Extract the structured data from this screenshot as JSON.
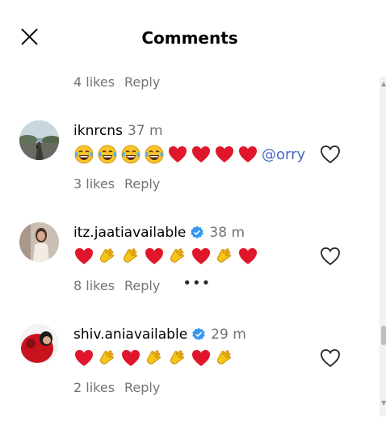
{
  "header": {
    "title": "Comments",
    "close_icon": "close-icon"
  },
  "top_meta": {
    "likes": "4 likes",
    "reply": "Reply"
  },
  "comments": [
    {
      "username": "iknrcns",
      "verified": false,
      "time": "37 m",
      "emojis": [
        "grin-tears",
        "grin-tears",
        "grin-tears",
        "grin-tears",
        "heart",
        "heart",
        "heart",
        "heart"
      ],
      "mention": "@orry",
      "likes": "3 likes",
      "reply": "Reply",
      "more": ""
    },
    {
      "username": "itz.jaatiavailable",
      "verified": true,
      "time": "38 m",
      "emojis": [
        "heart",
        "clap",
        "clap",
        "heart",
        "clap",
        "heart",
        "clap",
        "heart"
      ],
      "mention": "",
      "likes": "8 likes",
      "reply": "Reply",
      "more": "•••"
    },
    {
      "username": "shiv.aniavailable",
      "verified": true,
      "time": "29 m",
      "emojis": [
        "heart",
        "clap",
        "heart",
        "clap",
        "clap",
        "heart",
        "clap"
      ],
      "mention": "",
      "likes": "2 likes",
      "reply": "Reply",
      "more": ""
    }
  ],
  "colors": {
    "heart": "#e0172b",
    "clap": "#f5c518",
    "mention": "#4a67c9",
    "verified": "#3897f0",
    "meta": "#737373"
  }
}
